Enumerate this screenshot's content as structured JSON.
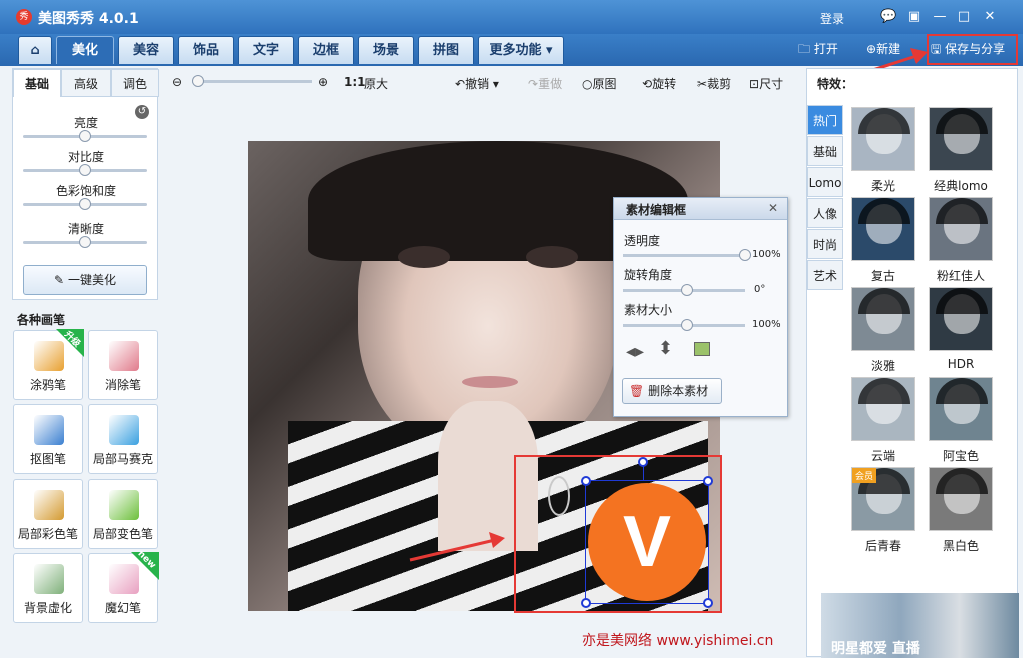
{
  "app": {
    "logo_glyph": "秀",
    "title": "美图秀秀 4.0.1",
    "login": "登录"
  },
  "window_controls": [
    "💬",
    "▣",
    "—",
    "□",
    "✕"
  ],
  "tabs": [
    {
      "label": "⌂"
    },
    {
      "label": "美化"
    },
    {
      "label": "美容"
    },
    {
      "label": "饰品"
    },
    {
      "label": "文字"
    },
    {
      "label": "边框"
    },
    {
      "label": "场景"
    },
    {
      "label": "拼图"
    },
    {
      "label": "更多功能 ▾"
    }
  ],
  "top_actions": {
    "open": "打开",
    "new": "新建",
    "save_share": "保存与分享"
  },
  "left": {
    "subtabs": [
      "基础",
      "高级",
      "调色"
    ],
    "sliders": [
      "亮度",
      "对比度",
      "色彩饱和度",
      "清晰度"
    ],
    "auto_button": "一键美化",
    "brush_title": "各种画笔",
    "tools": [
      {
        "label": "涂鸦笔",
        "badge": "升级",
        "color": "#e8a030"
      },
      {
        "label": "消除笔",
        "badge": "",
        "color": "#e07a8a"
      },
      {
        "label": "抠图笔",
        "badge": "",
        "color": "#3a7fd0"
      },
      {
        "label": "局部马赛克",
        "badge": "",
        "color": "#3aa0e0"
      },
      {
        "label": "局部彩色笔",
        "badge": "",
        "color": "#d49a30"
      },
      {
        "label": "局部变色笔",
        "badge": "",
        "color": "#6cbf3a"
      },
      {
        "label": "背景虚化",
        "badge": "",
        "color": "#7fb07a"
      },
      {
        "label": "魔幻笔",
        "badge": "new",
        "color": "#e8a0c0"
      }
    ]
  },
  "toolbar": {
    "zoom_ratio": "1:1",
    "original_size": "原大",
    "undo": "撤销",
    "redo": "重做",
    "original": "原图",
    "rotate": "旋转",
    "crop": "裁剪",
    "size": "尺寸"
  },
  "editor": {
    "title": "素材编辑框",
    "opacity_label": "透明度",
    "opacity_value": "100%",
    "opacity_level": 1.0,
    "rotate_label": "旋转角度",
    "rotate_value": "0°",
    "rotate_level": 0.5,
    "size_label": "素材大小",
    "size_value": "100%",
    "size_level": 0.5,
    "delete_button": "删除本素材"
  },
  "sticker": {
    "letter": "V",
    "color": "#f47321"
  },
  "effects": {
    "title": "特效：",
    "categories": [
      "热门",
      "基础",
      "Lomo",
      "人像",
      "时尚",
      "艺术"
    ],
    "items": [
      {
        "label": "柔光",
        "tone": "#a9b5c2",
        "badge": ""
      },
      {
        "label": "经典lomo",
        "tone": "#3b4650",
        "badge": ""
      },
      {
        "label": "复古",
        "tone": "#2b4a6a",
        "badge": ""
      },
      {
        "label": "粉红佳人",
        "tone": "#6a7480",
        "badge": ""
      },
      {
        "label": "淡雅",
        "tone": "#7e8a94",
        "badge": ""
      },
      {
        "label": "HDR",
        "tone": "#2f3a44",
        "badge": ""
      },
      {
        "label": "云端",
        "tone": "#aab6c0",
        "badge": ""
      },
      {
        "label": "阿宝色",
        "tone": "#6f8490",
        "badge": ""
      },
      {
        "label": "后青春",
        "tone": "#8a9aa4",
        "badge": "会员"
      },
      {
        "label": "黑白色",
        "tone": "#7a7a7a",
        "badge": ""
      }
    ]
  },
  "watermark": "亦是美网络 www.yishimei.cn",
  "ad_text": "明星都爱 直播"
}
